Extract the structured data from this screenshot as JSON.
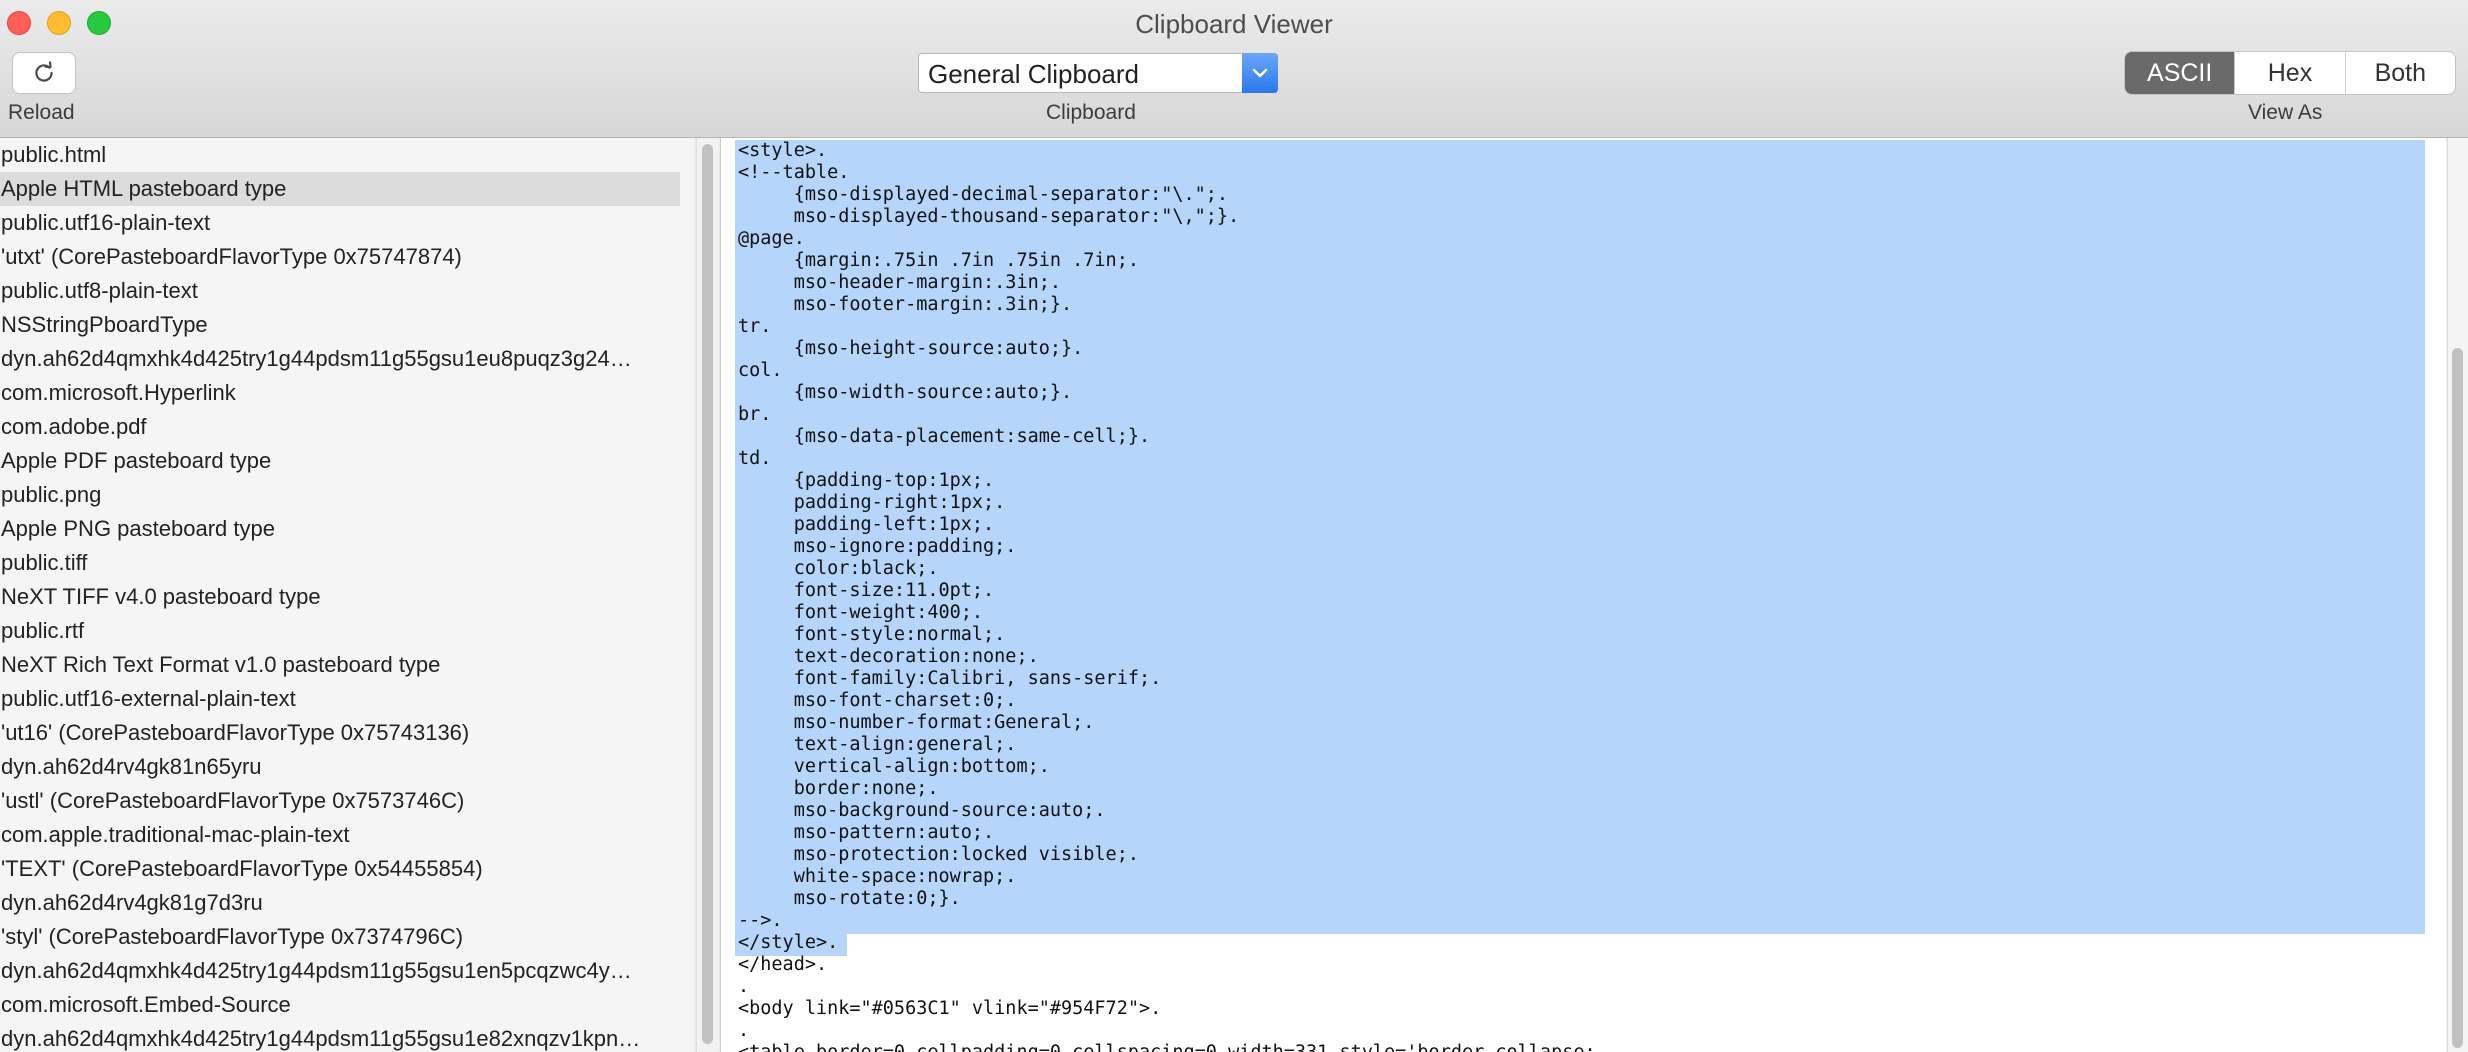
{
  "window": {
    "title": "Clipboard Viewer"
  },
  "toolbar": {
    "reload_label": "Reload",
    "clipboard_select": "General Clipboard",
    "clipboard_label": "Clipboard",
    "view_as_label": "View As",
    "view_modes": [
      "ASCII",
      "Hex",
      "Both"
    ],
    "active_view_mode": "ASCII"
  },
  "types_list": {
    "selected_index": 1,
    "items": [
      "public.html",
      "Apple HTML pasteboard type",
      "public.utf16-plain-text",
      "'utxt' (CorePasteboardFlavorType 0x75747874)",
      "public.utf8-plain-text",
      "NSStringPboardType",
      "dyn.ah62d4qmxhk4d425try1g44pdsm11g55gsu1eu8puqz3g24…",
      "com.microsoft.Hyperlink",
      "com.adobe.pdf",
      "Apple PDF pasteboard type",
      "public.png",
      "Apple PNG pasteboard type",
      "public.tiff",
      "NeXT TIFF v4.0 pasteboard type",
      "public.rtf",
      "NeXT Rich Text Format v1.0 pasteboard type",
      "public.utf16-external-plain-text",
      "'ut16' (CorePasteboardFlavorType 0x75743136)",
      "dyn.ah62d4rv4gk81n65yru",
      "'ustl' (CorePasteboardFlavorType 0x7573746C)",
      "com.apple.traditional-mac-plain-text",
      "'TEXT' (CorePasteboardFlavorType 0x54455854)",
      "dyn.ah62d4rv4gk81g7d3ru",
      "'styl' (CorePasteboardFlavorType 0x7374796C)",
      "dyn.ah62d4qmxhk4d425try1g44pdsm11g55gsu1en5pcqzwc4y…",
      "com.microsoft.Embed-Source",
      "dyn.ah62d4qmxhk4d425try1g44pdsm11g55gsu1e82xnqzv1kpn…"
    ]
  },
  "content": {
    "lines": [
      "<style>.",
      "<!--table.",
      "     {mso-displayed-decimal-separator:\"\\.\";.",
      "     mso-displayed-thousand-separator:\"\\,\";}.",
      "@page.",
      "     {margin:.75in .7in .75in .7in;.",
      "     mso-header-margin:.3in;.",
      "     mso-footer-margin:.3in;}.",
      "tr.",
      "     {mso-height-source:auto;}.",
      "col.",
      "     {mso-width-source:auto;}.",
      "br.",
      "     {mso-data-placement:same-cell;}.",
      "td.",
      "     {padding-top:1px;.",
      "     padding-right:1px;.",
      "     padding-left:1px;.",
      "     mso-ignore:padding;.",
      "     color:black;.",
      "     font-size:11.0pt;.",
      "     font-weight:400;.",
      "     font-style:normal;.",
      "     text-decoration:none;.",
      "     font-family:Calibri, sans-serif;.",
      "     mso-font-charset:0;.",
      "     mso-number-format:General;.",
      "     text-align:general;.",
      "     vertical-align:bottom;.",
      "     border:none;.",
      "     mso-background-source:auto;.",
      "     mso-pattern:auto;.",
      "     mso-protection:locked visible;.",
      "     white-space:nowrap;.",
      "     mso-rotate:0;}.",
      "-->.",
      "</style>.",
      "</head>.",
      ".",
      "<body link=\"#0563C1\" vlink=\"#954F72\">.",
      ".",
      "<table border=0 cellpadding=0 cellspacing=0 width=331 style='border-collapse:"
    ]
  }
}
